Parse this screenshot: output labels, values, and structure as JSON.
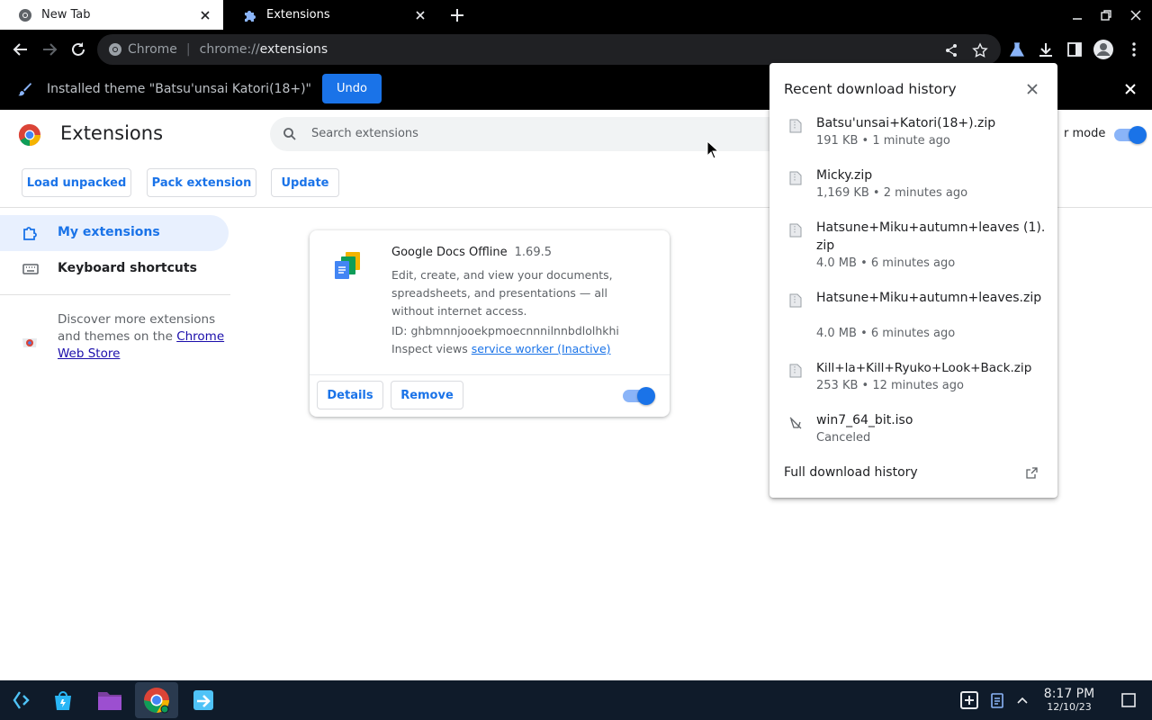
{
  "tabs": [
    {
      "title": "New Tab",
      "active": false
    },
    {
      "title": "Extensions",
      "active": true
    }
  ],
  "omnibox": {
    "site": "Chrome",
    "url_scheme": "chrome://",
    "url_host": "extensions"
  },
  "infobar": {
    "message": "Installed theme \"Batsu'unsai Katori(18+)\"",
    "undo_label": "Undo"
  },
  "page": {
    "title": "Extensions",
    "search_placeholder": "Search extensions",
    "dev_mode_label": "r mode",
    "dev_mode_on": true,
    "buttons": {
      "load_unpacked": "Load unpacked",
      "pack_extension": "Pack extension",
      "update": "Update"
    }
  },
  "sidebar": {
    "items": [
      {
        "label": "My extensions",
        "selected": true
      },
      {
        "label": "Keyboard shortcuts",
        "selected": false
      }
    ],
    "discover_text": "Discover more extensions and themes on the ",
    "webstore_link": "Chrome Web Store"
  },
  "extension_card": {
    "name": "Google Docs Offline",
    "version": "1.69.5",
    "description": "Edit, create, and view your documents, spreadsheets, and presentations — all without internet access.",
    "id_label": "ID: ghbmnnjooekpmoecnnnilnnbdlolhkhi",
    "inspect_label": "Inspect views",
    "inspect_link": "service worker (Inactive)",
    "details_label": "Details",
    "remove_label": "Remove",
    "enabled": true
  },
  "downloads": {
    "title": "Recent download history",
    "items": [
      {
        "name": "Batsu'unsai+Katori(18+).zip",
        "meta": "191 KB • 1 minute ago"
      },
      {
        "name": "Micky.zip",
        "meta": "1,169 KB • 2 minutes ago"
      },
      {
        "name": "Hatsune+Miku+autumn+leaves (1).zip",
        "meta": "4.0 MB • 6 minutes ago"
      },
      {
        "name": "Hatsune+Miku+autumn+leaves.zip",
        "meta": "4.0 MB • 6 minutes ago"
      },
      {
        "name": "Kill+la+Kill+Ryuko+Look+Back.zip",
        "meta": "253 KB • 12 minutes ago"
      },
      {
        "name": "win7_64_bit.iso",
        "meta": "Canceled"
      }
    ],
    "full_history_label": "Full download history"
  },
  "shelf": {
    "time": "8:17 PM",
    "date": "12/10/23"
  },
  "colors": {
    "accent": "#1a73e8",
    "chrome_dark": "#000000",
    "shelf": "#0f1b2a"
  }
}
